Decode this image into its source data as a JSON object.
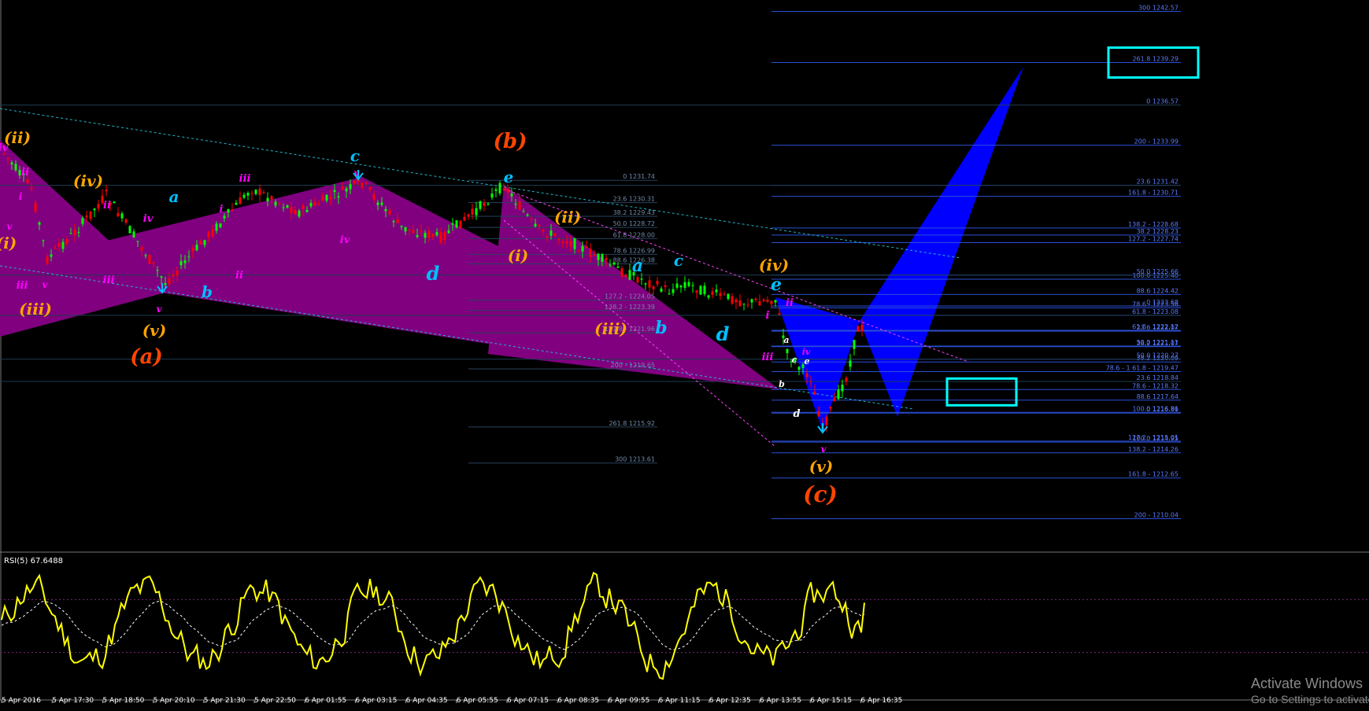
{
  "chart_data": {
    "type": "candlestick",
    "main": {
      "price_range": [
        1208.5,
        1243.0
      ],
      "upper_fib_levels": [
        {
          "label": "300 1242.57",
          "value": 1242.57
        },
        {
          "label": "261.8 1239.29",
          "value": 1239.29
        },
        {
          "label": "0 1236.57",
          "value": 1236.57
        },
        {
          "label": "200 - 1233.99",
          "value": 1233.99
        },
        {
          "label": "23.6 1231.42",
          "value": 1231.42
        },
        {
          "label": "161.8 - 1230.71",
          "value": 1230.71
        },
        {
          "label": "138.2 - 1228.68",
          "value": 1228.68
        },
        {
          "label": "38.2 1228.23",
          "value": 1228.23
        },
        {
          "label": "127.2 - 1227.74",
          "value": 1227.74
        },
        {
          "label": "50.0 1225.66",
          "value": 1225.66
        },
        {
          "label": "100.0 1225.40",
          "value": 1225.4
        },
        {
          "label": "88.6 1224.42",
          "value": 1224.42
        },
        {
          "label": "0 1223.68",
          "value": 1223.68
        },
        {
          "label": "78.6 - 1223.56",
          "value": 1223.56
        },
        {
          "label": "61.8 - 1223.08",
          "value": 1223.08
        },
        {
          "label": "61.8 - 1222.12",
          "value": 1222.12
        },
        {
          "label": "23.6 1222.07",
          "value": 1222.07
        },
        {
          "label": "38.2 1221.07",
          "value": 1221.07
        },
        {
          "label": "50.0 1221.11",
          "value": 1221.11
        },
        {
          "label": "50.0 1220.27",
          "value": 1220.27
        },
        {
          "label": "38.2 1220.09",
          "value": 1220.09
        },
        {
          "label": "78.6 - 1 61.8 - 1219.47",
          "value": 1219.47
        },
        {
          "label": "23.6 1218.84",
          "value": 1218.84
        },
        {
          "label": "78.6 - 1218.32",
          "value": 1218.32
        },
        {
          "label": "88.6 1217.64",
          "value": 1217.64
        },
        {
          "label": "100.0 1216.86",
          "value": 1216.86
        },
        {
          "label": "0 1216.81",
          "value": 1216.81
        },
        {
          "label": "127.2 - 1215.01",
          "value": 1215.01
        },
        {
          "label": "100.0 1214.95",
          "value": 1214.95
        },
        {
          "label": "138.2 - 1214.26",
          "value": 1214.26
        },
        {
          "label": "161.8 - 1212.65",
          "value": 1212.65
        },
        {
          "label": "200 - 1210.04",
          "value": 1210.04
        }
      ],
      "middle_fib_levels": [
        {
          "label": "0 1231.74",
          "value": 1231.74
        },
        {
          "label": "23.6 1230.31",
          "value": 1230.31
        },
        {
          "label": "38.2 1229.43",
          "value": 1229.43
        },
        {
          "label": "50.0 1228.72",
          "value": 1228.72
        },
        {
          "label": "61.8 1228.00",
          "value": 1228.0
        },
        {
          "label": "78.6 1226.99",
          "value": 1226.99
        },
        {
          "label": "88.6 1226.38",
          "value": 1226.38
        },
        {
          "label": "127.2 - 1224.05",
          "value": 1224.05
        },
        {
          "label": "138.2 - 1223.39",
          "value": 1223.39
        },
        {
          "label": "161.8 - 1221.96",
          "value": 1221.96
        },
        {
          "label": "200 - 1219.65",
          "value": 1219.65
        },
        {
          "label": "261.8 1215.92",
          "value": 1215.92
        },
        {
          "label": "300 1213.61",
          "value": 1213.61
        }
      ],
      "highlight_boxes": [
        "261.8 1239.29",
        "78.6 - 1218.32 / 88.6 1217.64"
      ],
      "wave_labels": [
        {
          "text": "(ii)",
          "color": "#ffa500"
        },
        {
          "text": "iv",
          "color": "#ff00ff"
        },
        {
          "text": "ii",
          "color": "#ff00ff"
        },
        {
          "text": "i",
          "color": "#ff00ff"
        },
        {
          "text": "v",
          "color": "#ff00ff"
        },
        {
          "text": "(i)",
          "color": "#ffa500"
        },
        {
          "text": "iii",
          "color": "#ff00ff"
        },
        {
          "text": "v",
          "color": "#ff00ff"
        },
        {
          "text": "(iii)",
          "color": "#ffa500"
        },
        {
          "text": "(iv)",
          "color": "#ffa500"
        },
        {
          "text": "ii",
          "color": "#ff00ff"
        },
        {
          "text": "iii",
          "color": "#ff00ff"
        },
        {
          "text": "a",
          "color": "#00bfff"
        },
        {
          "text": "iv",
          "color": "#ff00ff"
        },
        {
          "text": "v",
          "color": "#ff00ff"
        },
        {
          "text": "(v)",
          "color": "#ffa500"
        },
        {
          "text": "(a)",
          "color": "#ff4500"
        },
        {
          "text": "i",
          "color": "#ff00ff"
        },
        {
          "text": "b",
          "color": "#00bfff"
        },
        {
          "text": "iii",
          "color": "#ff00ff"
        },
        {
          "text": "ii",
          "color": "#ff00ff"
        },
        {
          "text": "c",
          "color": "#00bfff"
        },
        {
          "text": "v",
          "color": "#ff00ff"
        },
        {
          "text": "iv",
          "color": "#ff00ff"
        },
        {
          "text": "d",
          "color": "#00bfff"
        },
        {
          "text": "(b)",
          "color": "#ff4500"
        },
        {
          "text": "e",
          "color": "#00bfff"
        },
        {
          "text": "(ii)",
          "color": "#ffa500"
        },
        {
          "text": "(i)",
          "color": "#ffa500"
        },
        {
          "text": "a",
          "color": "#00bfff"
        },
        {
          "text": "c",
          "color": "#00bfff"
        },
        {
          "text": "(iii)",
          "color": "#ffa500"
        },
        {
          "text": "b",
          "color": "#00bfff"
        },
        {
          "text": "d",
          "color": "#00bfff"
        },
        {
          "text": "(iv)",
          "color": "#ffa500"
        },
        {
          "text": "e",
          "color": "#00bfff"
        },
        {
          "text": "ii",
          "color": "#ff00ff"
        },
        {
          "text": "i",
          "color": "#ff00ff"
        },
        {
          "text": "a",
          "color": "#ffffff"
        },
        {
          "text": "iii",
          "color": "#ff00ff"
        },
        {
          "text": "c",
          "color": "#ffffff"
        },
        {
          "text": "e",
          "color": "#ffffff"
        },
        {
          "text": "iv",
          "color": "#ff00ff"
        },
        {
          "text": "b",
          "color": "#ffffff"
        },
        {
          "text": "d",
          "color": "#ffffff"
        },
        {
          "text": "v",
          "color": "#ff00ff"
        },
        {
          "text": "(v)",
          "color": "#ffa500"
        },
        {
          "text": "(c)",
          "color": "#ff4500"
        }
      ],
      "colors": {
        "up_candle": "#00ff00",
        "down_candle": "#ff0000",
        "fib_lines": "#2b4fd6",
        "pattern_purple": "#800080",
        "pattern_blue": "#0000ff",
        "highlight": "#00ffff"
      }
    },
    "rsi": {
      "label": "RSI(5) 67.6488",
      "range": [
        0,
        100
      ],
      "levels": [
        70,
        30
      ],
      "last_value": 67.6488,
      "colors": {
        "rsi": "#ffff00",
        "signal": "#ffffff"
      }
    },
    "x_tick_labels": [
      "5 Apr 2016",
      "5 Apr 17:30",
      "5 Apr 18:50",
      "5 Apr 20:10",
      "5 Apr 21:30",
      "5 Apr 22:50",
      "6 Apr 01:55",
      "6 Apr 03:15",
      "6 Apr 04:35",
      "6 Apr 05:55",
      "6 Apr 07:15",
      "6 Apr 08:35",
      "6 Apr 09:55",
      "6 Apr 11:15",
      "6 Apr 12:35",
      "6 Apr 13:55",
      "6 Apr 15:15",
      "6 Apr 16:35"
    ]
  },
  "watermark": {
    "line1": "Activate Windows",
    "line2": "Go to Settings to activate Windows."
  }
}
